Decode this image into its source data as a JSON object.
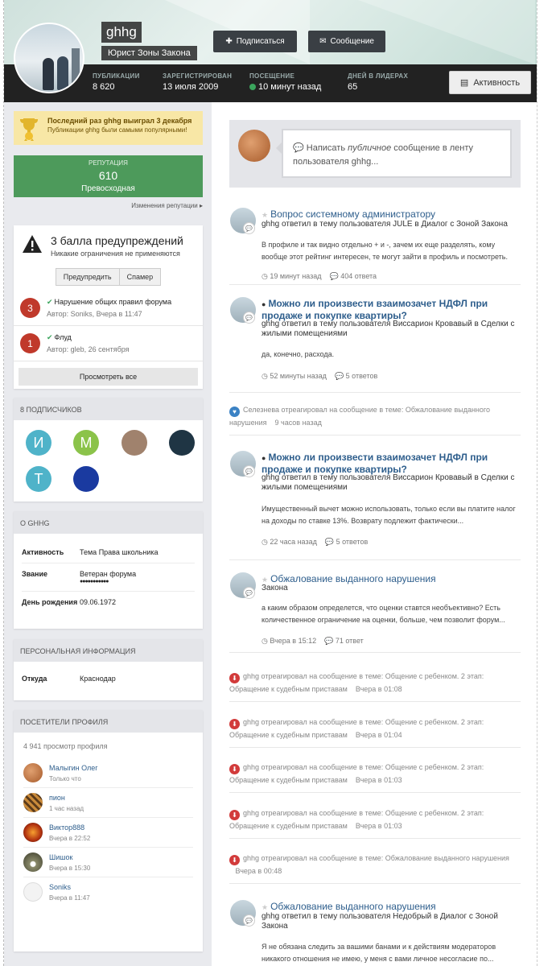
{
  "profile": {
    "username": "ghhg",
    "title": "Юрист Зоны Закона",
    "subscribe_label": "Подписаться",
    "message_label": "Сообщение",
    "activity_label": "Активность",
    "stats": [
      {
        "label": "ПУБЛИКАЦИИ",
        "value": "8 620"
      },
      {
        "label": "ЗАРЕГИСТРИРОВАН",
        "value": "13 июля 2009"
      },
      {
        "label": "ПОСЕЩЕНИЕ",
        "value": "10 минут назад"
      },
      {
        "label": "ДНЕЙ В ЛИДЕРАХ",
        "value": "65"
      }
    ]
  },
  "winner": {
    "title": "Последний раз ghhg выиграл 3 декабря",
    "subtitle": "Публикации ghhg были самыми популярными!"
  },
  "reputation": {
    "label": "РЕПУТАЦИЯ",
    "value": "610",
    "rank": "Превосходная",
    "changes_link": "Изменения репутации"
  },
  "warnings": {
    "title": "3 балла предупреждений",
    "subtitle": "Никакие ограничения не применяются",
    "btn_warn": "Предупредить",
    "btn_spam": "Спамер",
    "items": [
      {
        "points": "3",
        "title": "Нарушение общих правил форума",
        "meta": "Автор: Soniks, Вчера в 11:47"
      },
      {
        "points": "1",
        "title": "Флуд",
        "meta": "Автор: gleb, 26 сентября"
      }
    ],
    "view_all": "Просмотреть все"
  },
  "followers": {
    "heading": "8 ПОДПИСЧИКОВ",
    "items": [
      {
        "letter": "И",
        "color": "#4fb3c9"
      },
      {
        "letter": "М",
        "color": "#8bc34a"
      },
      {
        "letter": "",
        "color": "#a0826d"
      },
      {
        "letter": "",
        "color": "#1f3544"
      },
      {
        "letter": "Т",
        "color": "#4fb3c9"
      },
      {
        "letter": "",
        "color": "#1a3aa0"
      }
    ]
  },
  "about": {
    "heading": "О GHHG",
    "rows": [
      {
        "key": "Активность",
        "value": "Тема Права школьника"
      },
      {
        "key": "Звание",
        "value": "Ветеран форума"
      },
      {
        "key": "День рождения",
        "value": "09.06.1972"
      }
    ]
  },
  "personal": {
    "heading": "ПЕРСОНАЛЬНАЯ ИНФОРМАЦИЯ",
    "rows": [
      {
        "key": "Откуда",
        "value": "Краснодар"
      }
    ]
  },
  "visitors": {
    "heading": "ПОСЕТИТЕЛИ ПРОФИЛЯ",
    "count": "4 941 просмотр профиля",
    "items": [
      {
        "name": "Малыгин Олег",
        "time": "Только что"
      },
      {
        "name": "пион",
        "time": "1 час назад"
      },
      {
        "name": "Виктор888",
        "time": "Вчера в 22:52"
      },
      {
        "name": "Шишок",
        "time": "Вчера в 15:30"
      },
      {
        "name": "Soniks",
        "time": "Вчера в 11:47"
      }
    ]
  },
  "composer": {
    "pre": "Написать ",
    "em": "публичное",
    "post": " сообщение в ленту пользователя ghhg..."
  },
  "feed": {
    "f1": {
      "title": "Вопрос системному администратору",
      "sub": "ghhg ответил в тему пользователя JULE в Диалог с Зоной Закона",
      "text": "В профиле и так видно отдельно + и -, зачем их еще разделять, кому вообще этот рейтинг интересен, те могут зайти в профиль и посмотреть.",
      "time": "19 минут назад",
      "replies": "404 ответа"
    },
    "f2": {
      "title": "Можно ли произвести взаимозачет НДФЛ при продаже и покупке квартиры?",
      "sub": "ghhg ответил в тему пользователя Виссарион Кровавый в Сделки с жилыми помещениями",
      "text": "да, конечно, расхода.",
      "time": "52 минуты назад",
      "replies": "5 ответов"
    },
    "r1": {
      "text": "Селезнева отреагировал на сообщение в теме: Обжалование выданного нарушения",
      "time": "9 часов назад"
    },
    "f3": {
      "title": "Можно ли произвести взаимозачет НДФЛ при продаже и покупке квартиры?",
      "sub": "ghhg ответил в тему пользователя Виссарион Кровавый в Сделки с жилыми помещениями",
      "text": "Имущественный вычет можно использовать, только если вы платите налог на доходы по ставке 13%. Возврату подлежит фактически...",
      "time": "22 часа назад",
      "replies": "5 ответов"
    },
    "f4": {
      "title": "Обжалование выданного нарушения",
      "sub": "Закона",
      "text": "а каким образом определется, что оценки ставтся необъективно? Есть количественное ограничение на оценки, больше, чем позволит форум...",
      "time": "Вчера в 15:12",
      "replies": "71 ответ"
    },
    "r2": {
      "text": "ghhg отреагировал на сообщение в теме: Общение с ребенком. 2 этап: Обращение к судебным приставам",
      "time": "Вчера в 01:08"
    },
    "r3": {
      "text": "ghhg отреагировал на сообщение в теме: Общение с ребенком. 2 этап: Обращение к судебным приставам",
      "time": "Вчера в 01:04"
    },
    "r4": {
      "text": "ghhg отреагировал на сообщение в теме: Общение с ребенком. 2 этап: Обращение к судебным приставам",
      "time": "Вчера в 01:03"
    },
    "r5": {
      "text": "ghhg отреагировал на сообщение в теме: Общение с ребенком. 2 этап: Обращение к судебным приставам",
      "time": "Вчера в 01:03"
    },
    "r6": {
      "text": "ghhg отреагировал на сообщение в теме: Обжалование выданного нарушения",
      "time": "Вчера в 00:48"
    },
    "f5": {
      "title": "Обжалование выданного нарушения",
      "sub": "ghhg ответил в тему пользователя Недобрый в Диалог с Зоной Закона",
      "text": "Я не обязана следить за вашими банами и к действиям модераторов никакого отношения не имею, у меня с вами личное несогласие по..."
    }
  }
}
